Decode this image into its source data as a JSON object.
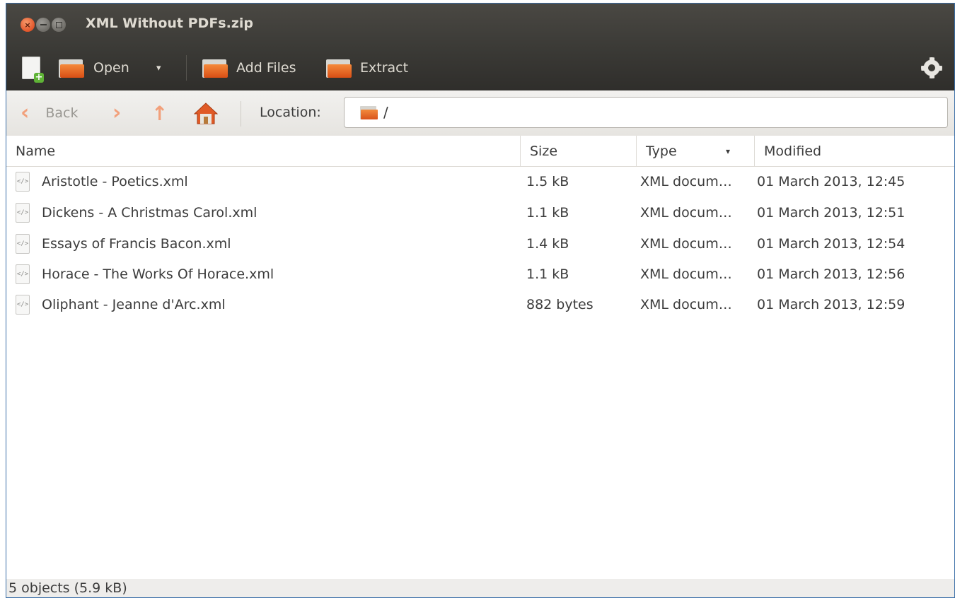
{
  "window": {
    "title": "XML Without PDFs.zip"
  },
  "toolbar": {
    "open_label": "Open",
    "open_menu_arrow": "▾",
    "add_files_label": "Add Files",
    "extract_label": "Extract"
  },
  "locationbar": {
    "back_label": "Back",
    "location_label": "Location:",
    "location_value": "/"
  },
  "columns": {
    "name": "Name",
    "size": "Size",
    "type": "Type",
    "type_sort_arrow": "▾",
    "modified": "Modified"
  },
  "files": [
    {
      "name": "Aristotle - Poetics.xml",
      "size": "1.5 kB",
      "type": "XML docum…",
      "modified": "01 March 2013, 12:45"
    },
    {
      "name": "Dickens - A Christmas Carol.xml",
      "size": "1.1 kB",
      "type": "XML docum…",
      "modified": "01 March 2013, 12:51"
    },
    {
      "name": "Essays of Francis Bacon.xml",
      "size": "1.4 kB",
      "type": "XML docum…",
      "modified": "01 March 2013, 12:54"
    },
    {
      "name": "Horace - The Works Of Horace.xml",
      "size": "1.1 kB",
      "type": "XML docum…",
      "modified": "01 March 2013, 12:56"
    },
    {
      "name": "Oliphant - Jeanne d'Arc.xml",
      "size": "882 bytes",
      "type": "XML docum…",
      "modified": "01 March 2013, 12:59"
    }
  ],
  "status": {
    "text": "5 objects (5.9 kB)"
  },
  "colors": {
    "titlebar": "#3c3b37",
    "close_button": "#e2552a",
    "folder_orange": "#e2621f",
    "nav_arrow": "#f2a07b"
  }
}
